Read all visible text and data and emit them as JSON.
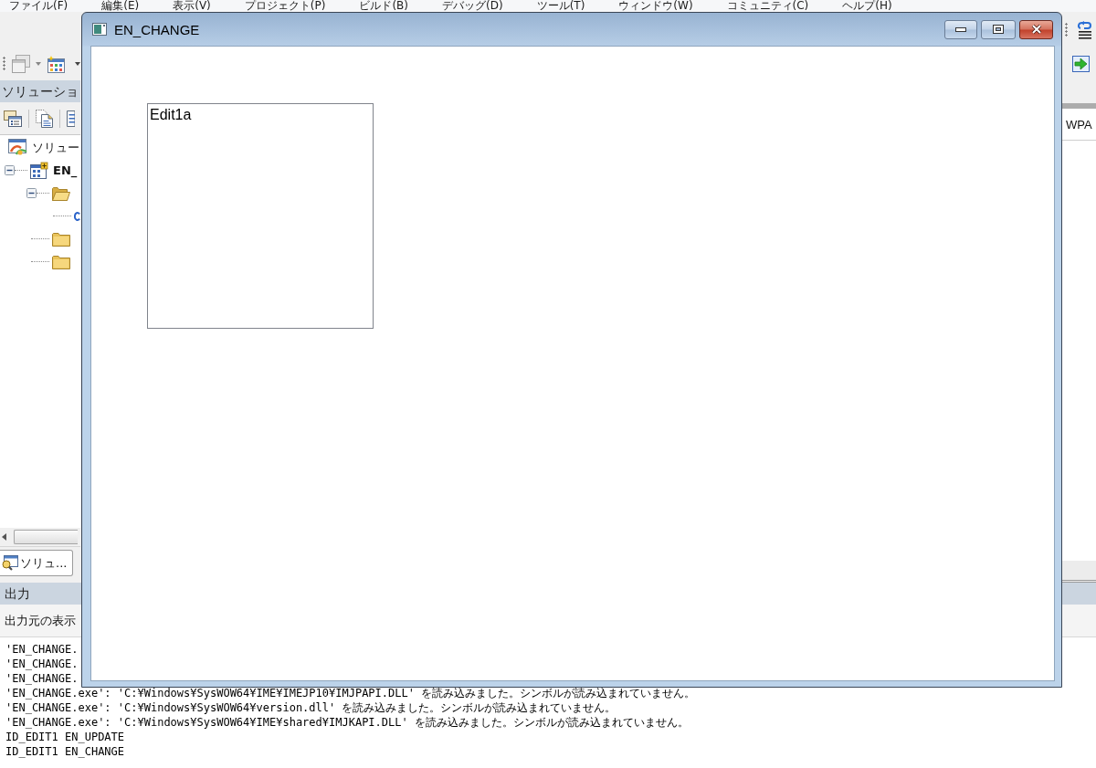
{
  "ide": {
    "menu": [
      "ファイル(F)",
      "編集(E)",
      "表示(V)",
      "プロジェクト(P)",
      "ビルド(B)",
      "デバッグ(D)",
      "ツール(T)",
      "ウィンドウ(W)",
      "コミュニティ(C)",
      "ヘルプ(H)"
    ],
    "solution_explorer": {
      "title": "ソリューショ",
      "tree": [
        {
          "label": "ソリュー",
          "kind": "solution",
          "children": [
            {
              "label": "EN_",
              "kind": "project",
              "expanded": true,
              "children": [
                {
                  "kind": "folder",
                  "expanded": true,
                  "children": [
                    {
                      "kind": "file"
                    }
                  ]
                },
                {
                  "kind": "folder",
                  "expanded": false
                },
                {
                  "kind": "folder",
                  "expanded": false
                }
              ]
            }
          ]
        }
      ],
      "tab": "ソリュ..."
    },
    "right_panel": {
      "tab": "WPA"
    },
    "output": {
      "title": "出力",
      "source_label": "出力元の表示",
      "lines": [
        "'EN_CHANGE.",
        "'EN_CHANGE.",
        "'EN_CHANGE.",
        "'EN_CHANGE.exe': 'C:¥Windows¥SysWOW64¥IME¥IMEJP10¥IMJPAPI.DLL' を読み込みました。シンボルが読み込まれていません。",
        "'EN_CHANGE.exe': 'C:¥Windows¥SysWOW64¥version.dll' を読み込みました。シンボルが読み込まれていません。",
        "'EN_CHANGE.exe': 'C:¥Windows¥SysWOW64¥IME¥shared¥IMJKAPI.DLL' を読み込みました。シンボルが読み込まれていません。",
        "ID_EDIT1 EN_UPDATE",
        "ID_EDIT1 EN_CHANGE"
      ]
    }
  },
  "window": {
    "title": "EN_CHANGE",
    "edit": {
      "value": "Edit1a"
    }
  }
}
